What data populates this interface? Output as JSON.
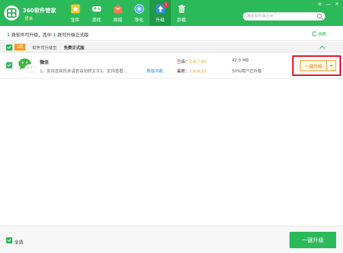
{
  "header": {
    "title": "360软件管家",
    "login": "登录",
    "nav": [
      {
        "label": "宝库",
        "icon": "star-icon"
      },
      {
        "label": "游戏",
        "icon": "gamepad-icon"
      },
      {
        "label": "商城",
        "icon": "shopping-bag-icon"
      },
      {
        "label": "净化",
        "icon": "shield-icon"
      },
      {
        "label": "升级",
        "icon": "upgrade-arrow-icon",
        "badge": "1",
        "active": true
      },
      {
        "label": "卸载",
        "icon": "trash-icon"
      }
    ],
    "search_placeholder": "搜索软件或应用",
    "colors": {
      "brand": "#2cb95a",
      "active_tab": "#1f9a47",
      "badge": "#e33"
    }
  },
  "info_bar": {
    "count1": "1",
    "text1": " 款软件可升级，其中 ",
    "count2": "1",
    "text2": " 款可升级正式版",
    "refresh": "刷新"
  },
  "group": {
    "badge": "1款",
    "text": "软件可升级至",
    "text_bold": "免费正式版"
  },
  "rows": [
    {
      "name": "微信",
      "description": "1、支持连续的来语音自动转文字2、支持查看...",
      "new_features": "新版功能",
      "installed_label": "已装：",
      "installed_version": "2.6.7.40",
      "latest_label": "最新：",
      "latest_version": "2.6.8.52",
      "size": "42.0 MB",
      "users": "50%用户已升级",
      "button": "一键升级"
    }
  ],
  "footer": {
    "select_all": "全选",
    "button": "一键升级"
  }
}
